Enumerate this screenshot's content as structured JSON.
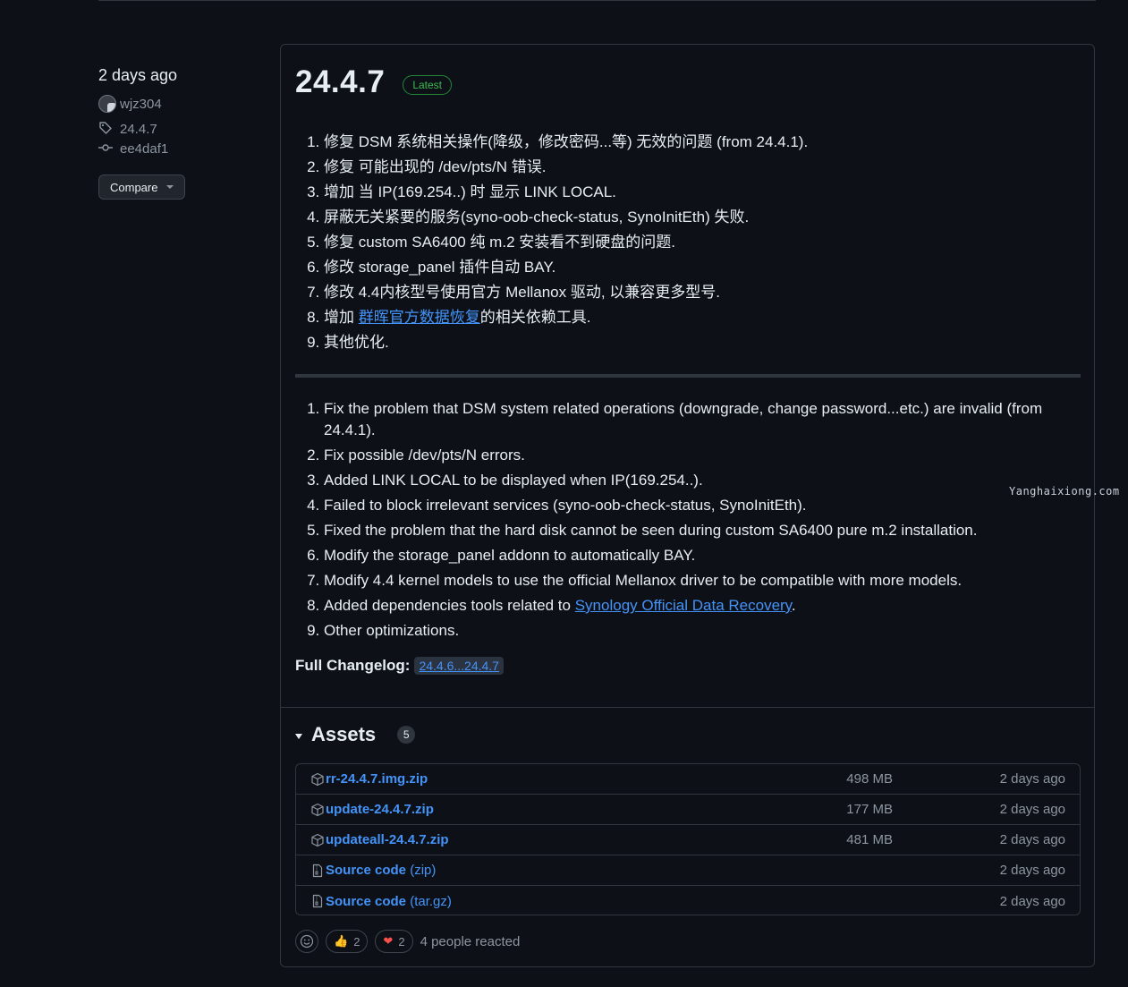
{
  "meta": {
    "published": "2 days ago",
    "author": "wjz304",
    "tag": "24.4.7",
    "commit": "ee4daf1",
    "compare_label": "Compare"
  },
  "release": {
    "title": "24.4.7",
    "badge": "Latest",
    "notes_zh": [
      {
        "text": "修复 DSM 系统相关操作(降级，修改密码...等) 无效的问题 (from 24.4.1)."
      },
      {
        "text": "修复 可能出现的 /dev/pts/N 错误."
      },
      {
        "text": "增加 当 IP(169.254..) 时 显示 LINK LOCAL."
      },
      {
        "text": "屏蔽无关紧要的服务(syno-oob-check-status, SynoInitEth) 失败."
      },
      {
        "text": "修复 custom SA6400 纯 m.2 安装看不到硬盘的问题."
      },
      {
        "text": "修改 storage_panel 插件自动 BAY."
      },
      {
        "text": "修改 4.4内核型号使用官方 Mellanox 驱动, 以兼容更多型号."
      },
      {
        "pre": "增加 ",
        "link": "群晖官方数据恢复",
        "post": "的相关依赖工具."
      },
      {
        "text": "其他优化."
      }
    ],
    "notes_en": [
      {
        "text": "Fix the problem that DSM system related operations (downgrade, change password...etc.) are invalid (from 24.4.1)."
      },
      {
        "text": "Fix possible /dev/pts/N errors."
      },
      {
        "text": "Added LINK LOCAL to be displayed when IP(169.254..)."
      },
      {
        "text": "Failed to block irrelevant services (syno-oob-check-status, SynoInitEth)."
      },
      {
        "text": "Fixed the problem that the hard disk cannot be seen during custom SA6400 pure m.2 installation."
      },
      {
        "text": "Modify the storage_panel addonn to automatically BAY."
      },
      {
        "text": "Modify 4.4 kernel models to use the official Mellanox driver to be compatible with more models."
      },
      {
        "pre": "Added dependencies tools related to ",
        "link": "Synology Official Data Recovery",
        "post": "."
      },
      {
        "text": "Other optimizations."
      }
    ],
    "changelog_label": "Full Changelog:",
    "changelog_link": "24.4.6...24.4.7"
  },
  "assets": {
    "title": "Assets",
    "count": "5",
    "items": [
      {
        "icon": "package-icon",
        "name": "rr-24.4.7.img.zip",
        "sub": "",
        "size": "498 MB",
        "date": "2 days ago"
      },
      {
        "icon": "package-icon",
        "name": "update-24.4.7.zip",
        "sub": "",
        "size": "177 MB",
        "date": "2 days ago"
      },
      {
        "icon": "package-icon",
        "name": "updateall-24.4.7.zip",
        "sub": "",
        "size": "481 MB",
        "date": "2 days ago"
      },
      {
        "icon": "file-zip-icon",
        "name": "Source code",
        "sub": " (zip)",
        "size": "",
        "date": "2 days ago"
      },
      {
        "icon": "file-zip-icon",
        "name": "Source code",
        "sub": " (tar.gz)",
        "size": "",
        "date": "2 days ago"
      }
    ]
  },
  "reactions": {
    "thumbs_up": {
      "emoji": "👍",
      "count": "2"
    },
    "heart": {
      "emoji": "❤",
      "count": "2"
    },
    "summary": "4 people reacted"
  },
  "watermark": "Yanghaixiong.com",
  "colors": {
    "background": "#0d1117",
    "link": "#4493f8",
    "badge": "#3fb950",
    "muted": "#8d96a0",
    "border": "#30363d"
  }
}
